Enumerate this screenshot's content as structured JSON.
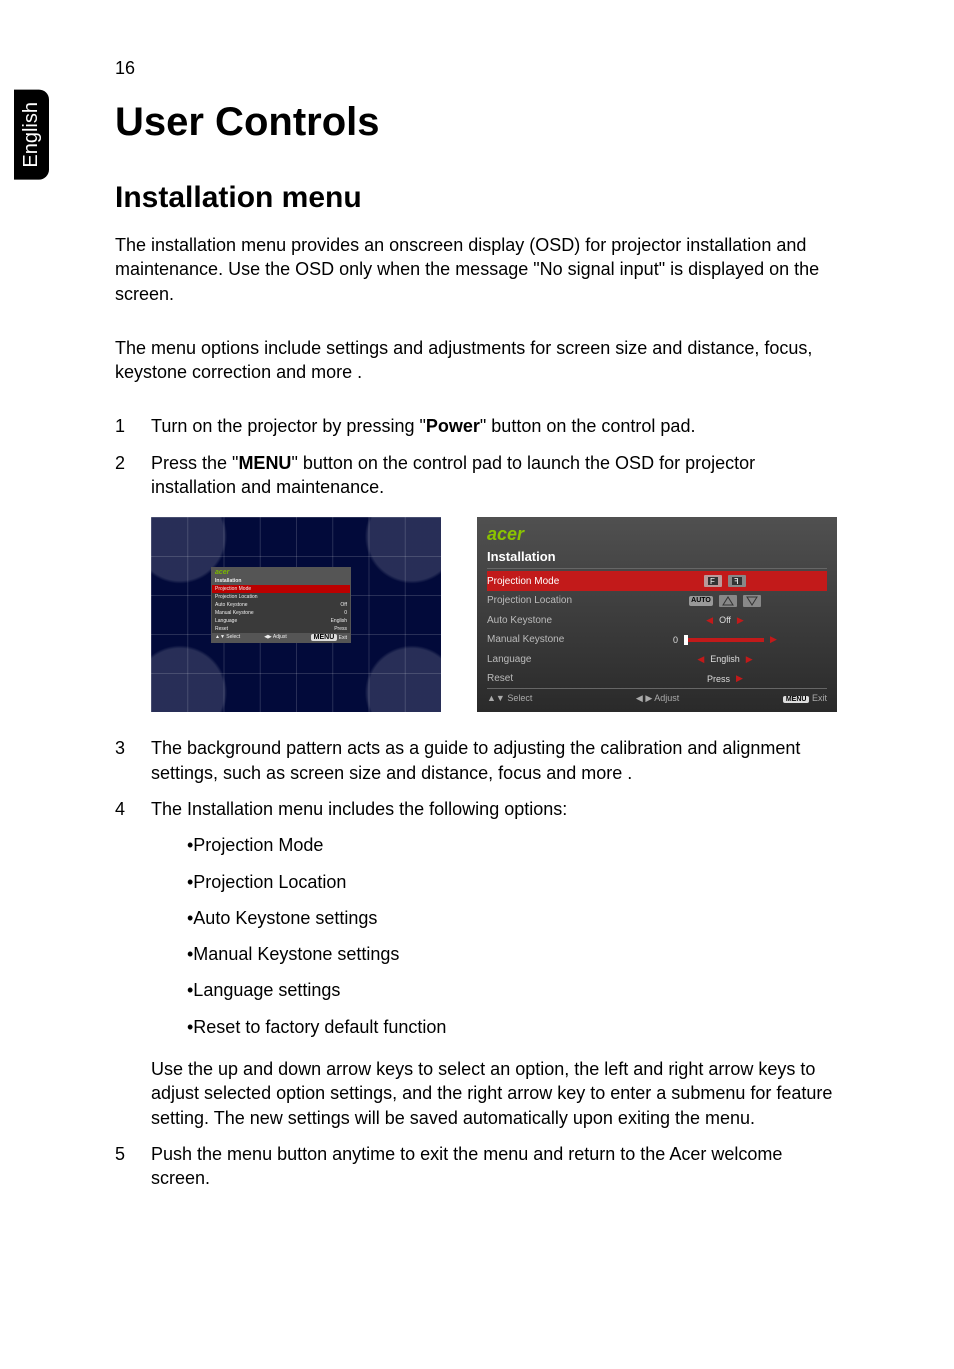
{
  "pageNumber": "16",
  "sideTab": "English",
  "heading1": "User Controls",
  "heading2": "Installation menu",
  "intro1": "The installation menu provides an onscreen display (OSD) for projector installation and maintenance. Use the OSD only when the message \"No signal input\" is displayed on the screen.",
  "intro2": "The menu options include settings and adjustments for screen size and distance, focus, keystone correction and more .",
  "steps": {
    "s1": {
      "num": "1",
      "pre": "Turn on the projector by pressing \"",
      "bold": "Power",
      "post": "\" button on the control pad."
    },
    "s2": {
      "num": "2",
      "pre": "Press the \"",
      "bold": "MENU",
      "post": "\" button on the control pad to launch the OSD for projector installation and maintenance."
    },
    "s3": {
      "num": "3",
      "text": "The background pattern acts as a guide to adjusting the calibration and alignment settings, such as screen size and distance, focus and more ."
    },
    "s4": {
      "num": "4",
      "text": "The Installation menu includes the following options:",
      "bullets": {
        "b1": "•Projection Mode",
        "b2": "•Projection Location",
        "b3": "•Auto Keystone settings",
        "b4": "•Manual Keystone settings",
        "b5": "•Language settings",
        "b6": "•Reset to factory default function"
      },
      "tail": "Use the up and down arrow keys to select an option, the left and right arrow keys to adjust selected option settings, and the right arrow key to enter a submenu for feature setting. The new settings will be saved automatically upon exiting the menu."
    },
    "s5": {
      "num": "5",
      "text": "Push the menu button anytime to exit the menu and return to the Acer welcome screen."
    }
  },
  "osd": {
    "brand": "acer",
    "title": "Installation",
    "rows": {
      "projMode": "Projection Mode",
      "projLoc": "Projection Location",
      "autoKey": "Auto Keystone",
      "autoKeyVal": "Off",
      "manKey": "Manual Keystone",
      "manKeyVal": "0",
      "lang": "Language",
      "langVal": "English",
      "reset": "Reset",
      "resetVal": "Press"
    },
    "badges": {
      "auto": "AUTO",
      "menu": "MENU"
    },
    "footer": {
      "select": "Select",
      "adjust": "Adjust",
      "exit": "Exit"
    }
  }
}
